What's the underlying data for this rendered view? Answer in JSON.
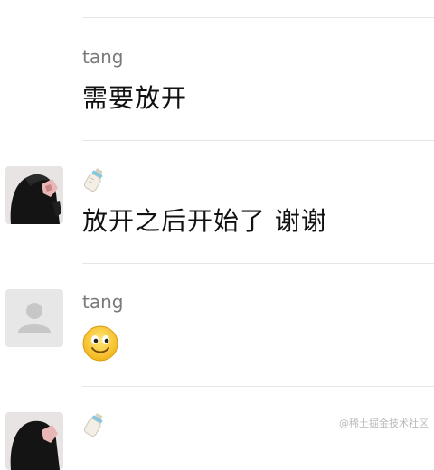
{
  "messages": [
    {
      "sender": "tang",
      "text": "需要放开",
      "avatar": "none"
    },
    {
      "sender": "bottle-emoji",
      "text": "放开之后开始了 谢谢",
      "avatar": "dark-hair-photo"
    },
    {
      "sender": "tang",
      "text": "",
      "emoji": "smile-emoji",
      "avatar": "default-person"
    },
    {
      "sender": "bottle-emoji",
      "text": "",
      "avatar": "dark-hair-photo"
    }
  ],
  "watermark": "@稀土掘金技术社区"
}
